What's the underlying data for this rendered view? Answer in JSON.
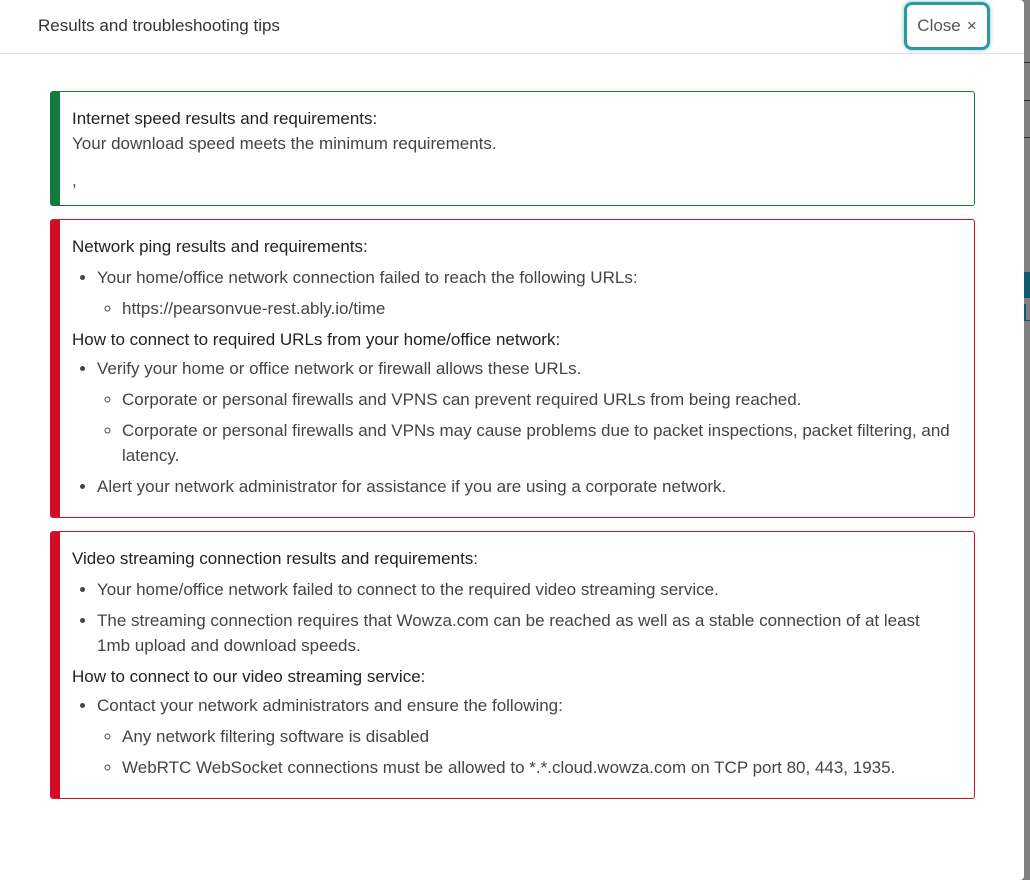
{
  "modal": {
    "title": "Results and troubleshooting tips",
    "close_label": "Close",
    "close_icon": "×"
  },
  "colors": {
    "success": "#117a3c",
    "danger": "#d40a26",
    "close_focus": "#2a9aa0"
  },
  "sections": {
    "internet_speed": {
      "status": "success",
      "heading": "Internet speed results and requirements:",
      "message": "Your download speed meets the minimum requirements.",
      "trailing": ","
    },
    "network_ping": {
      "status": "failure",
      "heading": "Network ping results and requirements:",
      "results": [
        {
          "text": "Your home/office network connection failed to reach the following URLs:",
          "subitems": [
            "https://pearsonvue-rest.ably.io/time"
          ]
        }
      ],
      "howto_heading": "How to connect to required URLs from your home/office network:",
      "howto": [
        {
          "text": "Verify your home or office network or firewall allows these URLs.",
          "subitems": [
            "Corporate or personal firewalls and VPNS can prevent required URLs from being reached.",
            "Corporate or personal firewalls and VPNs may cause problems due to packet inspections, packet filtering, and latency."
          ]
        },
        {
          "text": "Alert your network administrator for assistance if you are using a corporate network."
        }
      ]
    },
    "video_streaming": {
      "status": "failure",
      "heading": "Video streaming connection results and requirements:",
      "results": [
        "Your home/office network failed to connect to the required video streaming service.",
        "The streaming connection requires that Wowza.com can be reached as well as a stable connection of at least 1mb upload and download speeds."
      ],
      "howto_heading": "How to connect to our video streaming service:",
      "howto": [
        {
          "text": "Contact your network administrators and ensure the following:",
          "subitems": [
            "Any network filtering software is disabled",
            "WebRTC WebSocket connections must be allowed to *.*.cloud.wowza.com on TCP port 80, 443, 1935."
          ]
        }
      ]
    }
  }
}
